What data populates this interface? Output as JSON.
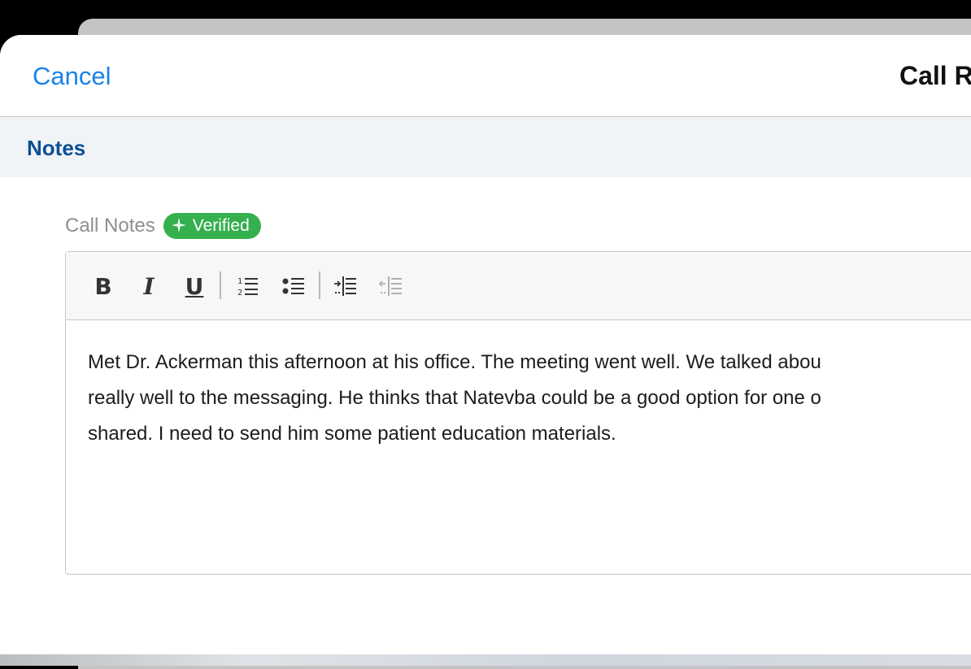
{
  "nav": {
    "cancel_label": "Cancel",
    "title": "Call R"
  },
  "section": {
    "title": "Notes"
  },
  "call_notes": {
    "label": "Call Notes",
    "badge_label": "Verified",
    "badge_icon": "sparkle-icon",
    "badge_color": "#34b04f"
  },
  "toolbar": {
    "bold_label": "B",
    "italic_label": "I",
    "underline_label": "U",
    "tools": [
      "bold",
      "italic",
      "underline",
      "numbered-list",
      "bulleted-list",
      "indent",
      "outdent"
    ]
  },
  "editor": {
    "lines": [
      "Met Dr. Ackerman this afternoon at his office. The meeting went well. We talked abou",
      "really well to the messaging. He thinks that Natevba could be a good option for one o",
      "shared. I need to send him some patient education materials."
    ]
  },
  "colors": {
    "accent": "#1a82e8",
    "section_title": "#0d4f94",
    "section_bg": "#f1f4f7"
  }
}
